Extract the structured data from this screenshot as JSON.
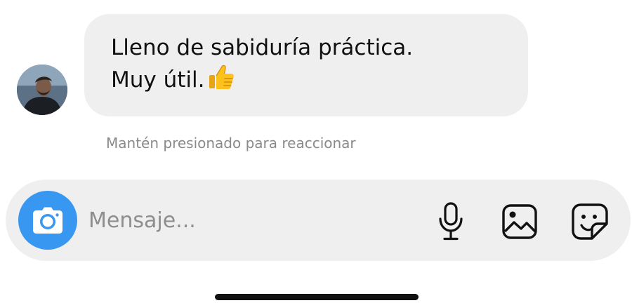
{
  "message": {
    "lines": [
      "Lleno de sabiduría práctica.",
      "Muy útil."
    ],
    "emoji": "thumbs-up-emoji"
  },
  "hint_text": "Mantén presionado para reaccionar",
  "composer": {
    "placeholder": "Mensaje...",
    "value": "",
    "icons": [
      "camera-icon",
      "microphone-icon",
      "gallery-icon",
      "sticker-icon"
    ]
  },
  "colors": {
    "accent": "#3897f0",
    "bubble_bg": "#efefef",
    "composer_bg": "#efefef",
    "hint_text": "#8a8a8a"
  }
}
